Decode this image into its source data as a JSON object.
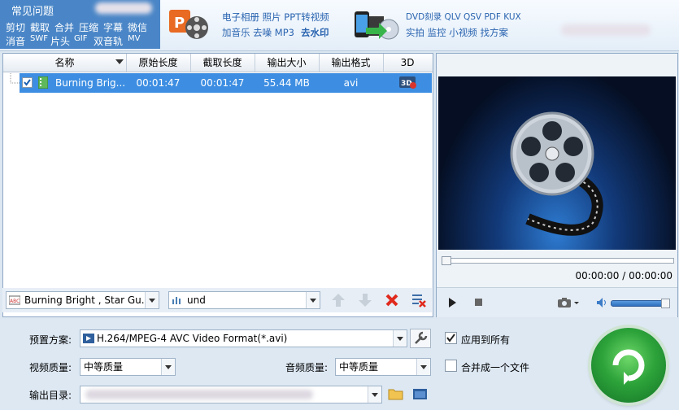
{
  "banner": {
    "faq_title": "常见问题",
    "quick_links": [
      "剪切",
      "截取",
      "合并",
      "压缩",
      "字幕",
      "微信",
      "消音",
      "SWF",
      "片头",
      "GIF",
      "双音轨",
      "MV"
    ],
    "promo1_line1": "电子相册 照片 PPT转视频",
    "promo1_line2": "加音乐 去噪 MP3",
    "promo1_bold": "去水印",
    "promo2_line1": "DVD刻录 QLV QSV PDF KUX",
    "promo2_line2": "实拍 监控 小视频 找方案"
  },
  "file_list": {
    "columns": [
      "名称",
      "原始长度",
      "截取长度",
      "输出大小",
      "输出格式",
      "3D"
    ],
    "rows": [
      {
        "name": "Burning Brig...",
        "original_length": "00:01:47",
        "clip_length": "00:01:47",
        "output_size": "55.44 MB",
        "output_format": "avi",
        "checked": true
      }
    ]
  },
  "list_toolbar": {
    "subtitle_select": "Burning Bright , Star Gu...",
    "audio_select": "und"
  },
  "preview": {
    "time_display": "00:00:00 / 00:00:00"
  },
  "settings": {
    "preset_label": "预置方案:",
    "preset_value": "H.264/MPEG-4 AVC Video Format(*.avi)",
    "apply_all_label": "应用到所有",
    "apply_all_checked": true,
    "video_quality_label": "视频质量:",
    "video_quality_value": "中等质量",
    "audio_quality_label": "音频质量:",
    "audio_quality_value": "中等质量",
    "merge_label": "合并成一个文件",
    "merge_checked": false,
    "output_dir_label": "输出目录:"
  },
  "colors": {
    "selection": "#3d8ee2",
    "banner_panel": "#4a86c7",
    "go_button": "#2da33a"
  }
}
